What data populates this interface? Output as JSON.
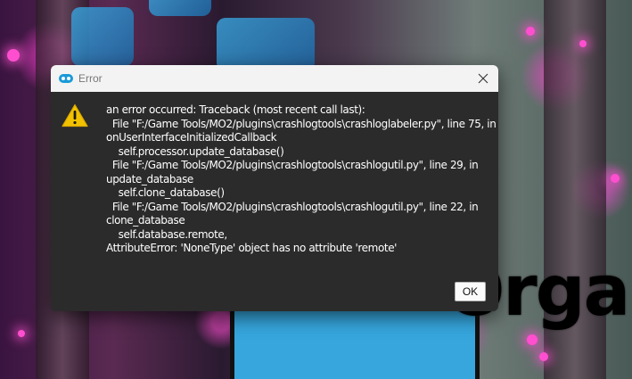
{
  "dialog": {
    "title": "Error",
    "app_icon": "mo2-app-icon",
    "close_icon": "close-icon",
    "warning_icon": "warning-triangle-icon",
    "message_lines": [
      "an error occurred: Traceback (most recent call last):",
      "  File \"F:/Game Tools/MO2/plugins\\crashlogtools\\crashloglabeler.py\", line 75, in",
      "onUserInterfaceInitializedCallback",
      "    self.processor.update_database()",
      "  File \"F:/Game Tools/MO2/plugins\\crashlogtools\\crashlogutil.py\", line 29, in",
      "update_database",
      "    self.clone_database()",
      "  File \"F:/Game Tools/MO2/plugins\\crashlogtools\\crashlogutil.py\", line 22, in",
      "clone_database",
      "    self.database.remote,",
      "AttributeError: 'NoneType' object has no attribute 'remote'"
    ],
    "ok_label": "OK"
  },
  "background": {
    "logo_text": "Organiz",
    "accent_color": "#36a6dd",
    "glow_color": "#ff4fd0"
  }
}
